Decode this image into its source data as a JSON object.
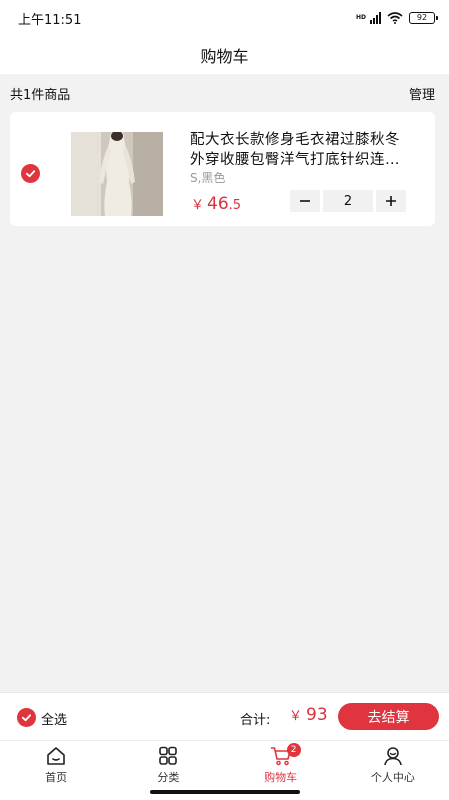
{
  "status_bar": {
    "time": "上午11:51",
    "battery": "92",
    "network": "HD"
  },
  "nav": {
    "title": "购物车"
  },
  "summary": {
    "count_text": "共1件商品",
    "manage_label": "管理"
  },
  "cart_items": [
    {
      "title": "配大衣长款修身毛衣裙过膝秋冬外穿收腰包臀洋气打底针织连衣裙",
      "spec": "S,黑色",
      "currency": "￥",
      "price_int": "46",
      "price_dec": ".5",
      "quantity": "2",
      "selected": true
    }
  ],
  "checkout": {
    "select_all_label": "全选",
    "total_label": "合计:",
    "currency": "￥",
    "total": "93",
    "checkout_label": "去结算"
  },
  "tabs": [
    {
      "label": "首页",
      "icon": "home-icon",
      "active": false
    },
    {
      "label": "分类",
      "icon": "category-icon",
      "active": false
    },
    {
      "label": "购物车",
      "icon": "cart-icon",
      "active": true,
      "badge": "2"
    },
    {
      "label": "个人中心",
      "icon": "profile-icon",
      "active": false
    }
  ],
  "colors": {
    "accent": "#e0343f",
    "price": "#d9323f",
    "background": "#f2f2f2"
  }
}
